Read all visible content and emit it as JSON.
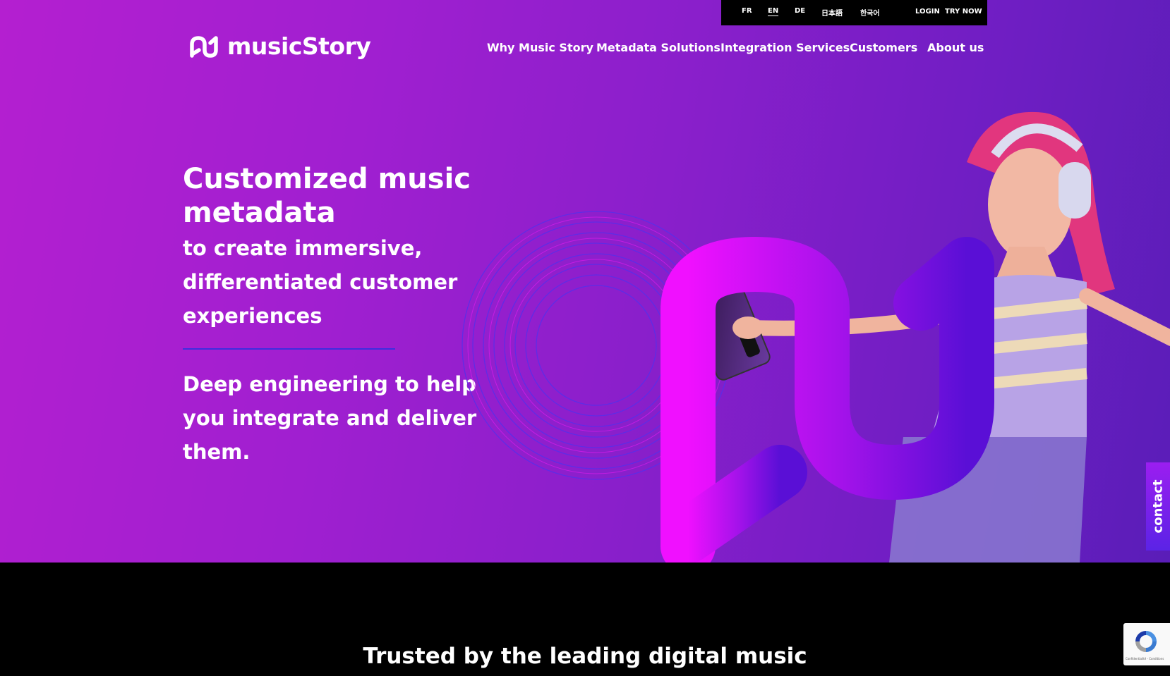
{
  "languages": [
    {
      "code": "FR",
      "active": false
    },
    {
      "code": "EN",
      "active": true
    },
    {
      "code": "DE",
      "active": false
    },
    {
      "code": "日本語",
      "active": false
    },
    {
      "code": "한국어",
      "active": false
    }
  ],
  "utility": {
    "login": "LOGIN",
    "try_now": "TRY NOW"
  },
  "brand": {
    "name": "musicStory"
  },
  "nav": [
    {
      "label": "Why Music Story"
    },
    {
      "label": "Metadata Solutions"
    },
    {
      "label": "Integration Services"
    },
    {
      "label": "Customers"
    },
    {
      "label": "About us"
    }
  ],
  "hero": {
    "headline": "Customized music metadata",
    "subheadline": "to create immersive, differentiated customer experiences",
    "tagline": "Deep engineering to help you integrate and deliver them."
  },
  "contact_tab": {
    "label": "contact"
  },
  "trusted": {
    "title": "Trusted by the leading digital music"
  },
  "recaptcha": {
    "links": "Confidentialité - Conditions"
  },
  "colors": {
    "hero_gradient_start": "#b41fd0",
    "hero_gradient_end": "#5a1db8",
    "logo_magenta": "#f010ff",
    "logo_violet": "#7a12e0",
    "divider": "#3d2ee0",
    "section_bg": "#000000"
  },
  "icons": {
    "brand_logo": "musicstory-logo-icon",
    "recaptcha": "recaptcha-icon"
  }
}
